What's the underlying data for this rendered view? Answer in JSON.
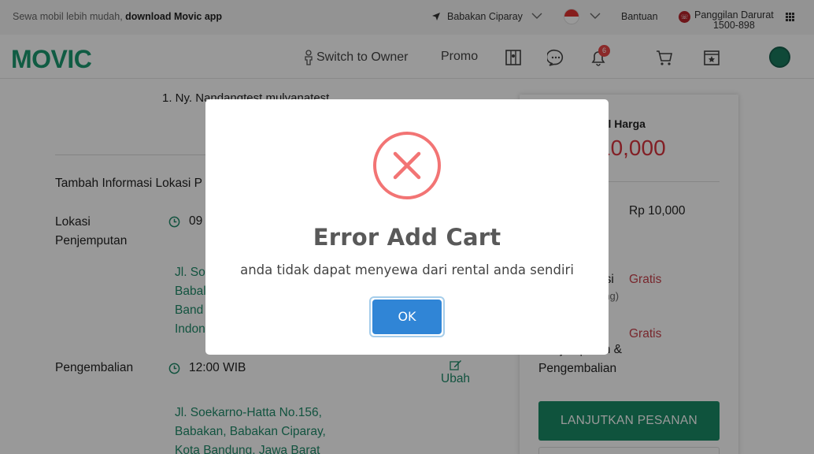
{
  "topbar": {
    "promo_text": "Sewa mobil lebih mudah, ",
    "promo_link": "download Movic app",
    "location": "Babakan Ciparay",
    "help": "Bantuan",
    "emergency_label": "Panggilan Darurat",
    "emergency_number": "1500-898"
  },
  "nav": {
    "logo": "MOVIC",
    "switch_owner": "Switch to Owner",
    "promo": "Promo",
    "notification_count": "6"
  },
  "page": {
    "renter_name": "1. Ny. Nandangtest mulyanatest",
    "add_location_info": "Tambah Informasi Lokasi P",
    "pickup_label_1": "Lokasi",
    "pickup_label_2": "Penjemputan",
    "pickup_time": "09",
    "pickup_address": [
      "Jl. So",
      "Babal",
      "Band",
      "Indon"
    ],
    "return_label": "Pengembalian",
    "return_time": "12:00 WIB",
    "return_address": [
      "Jl. Soekarno-Hatta No.156,",
      "Babakan, Babakan Ciparay,",
      "Kota Bandung, Jawa Barat"
    ],
    "edit_label": "Ubah"
  },
  "summary": {
    "total_label": "tal Harga",
    "total_value": "10,000",
    "price": "Rp 10,000",
    "ansi_label": "nsi",
    "free_1": "Gratis",
    "small_text": "ang)",
    "red_small": "n",
    "free_2": "Gratis",
    "pickup_return_1": "Penjemputan &",
    "pickup_return_2": "Pengembalian",
    "continue_button": "LANJUTKAN PESANAN"
  },
  "modal": {
    "title": "Error Add Cart",
    "message": "anda tidak dapat menyewa dari rental anda sendiri",
    "ok_label": "OK"
  },
  "colors": {
    "brand_green": "#1a8a66",
    "error_red": "#f27474",
    "ok_blue": "#3085d6",
    "price_red": "#d9343f"
  }
}
